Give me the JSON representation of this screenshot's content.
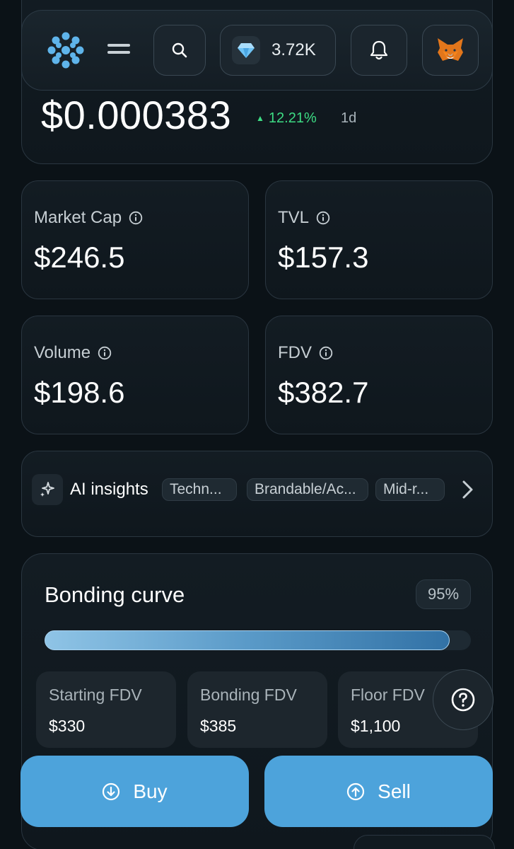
{
  "header": {
    "gems_value": "3.72K"
  },
  "price": {
    "value": "$0.000383",
    "change": "12.21%",
    "period": "1d"
  },
  "stats": [
    {
      "label": "Market Cap",
      "value": "$246.5"
    },
    {
      "label": "TVL",
      "value": "$157.3"
    },
    {
      "label": "Volume",
      "value": "$198.6"
    },
    {
      "label": "FDV",
      "value": "$382.7"
    }
  ],
  "ai_insights": {
    "label": "AI insights",
    "chips": [
      "Techn...",
      "Brandable/Ac...",
      "Mid-r..."
    ]
  },
  "bonding_curve": {
    "title": "Bonding curve",
    "percent_label": "95%",
    "progress": 0.95,
    "items": [
      {
        "label": "Starting FDV",
        "value": "$330"
      },
      {
        "label": "Bonding FDV",
        "value": "$385"
      },
      {
        "label": "Floor FDV",
        "value": "$1,100"
      }
    ]
  },
  "actions": {
    "buy_label": "Buy",
    "sell_label": "Sell"
  },
  "colors": {
    "accent": "#4da3db",
    "positive": "#3ddc84",
    "background": "#0b1217"
  },
  "icons": [
    "logo-icon",
    "menu-icon",
    "search-icon",
    "gem-icon",
    "bell-icon",
    "fox-wallet-icon",
    "info-icon",
    "sparkle-icon",
    "chevron-right-icon",
    "help-icon",
    "arrow-down-circle-icon",
    "arrow-up-circle-icon"
  ]
}
